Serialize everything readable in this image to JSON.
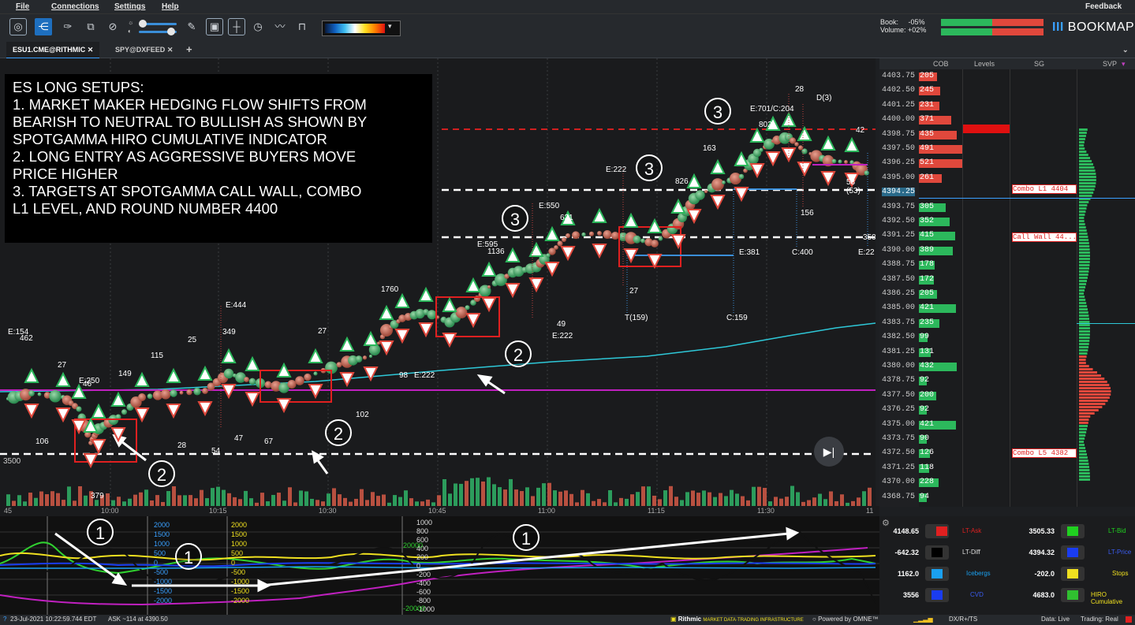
{
  "menu": {
    "file": "File",
    "connections": "Connections",
    "settings": "Settings",
    "help": "Help",
    "feedback": "Feedback"
  },
  "header": {
    "book_label": "Book:",
    "book_value": "-05%",
    "volume_label": "Volume:",
    "volume_value": "+02%",
    "brand": "BOOKMAP"
  },
  "tabs": [
    {
      "label": "ESU1.CME@RITHMIC"
    },
    {
      "label": "SPY@DXFEED"
    }
  ],
  "annotation": {
    "lines": [
      "ES LONG SETUPS:",
      "1. MARKET MAKER HEDGING FLOW SHIFTS FROM",
      "BEARISH TO NEUTRAL TO BULLISH AS SHOWN BY",
      "SPOTGAMMA HIRO CUMULATIVE INDICATOR",
      "2. LONG ENTRY AS AGGRESSIVE BUYERS MOVE",
      "PRICE HIGHER",
      "3. TARGETS AT SPOTGAMMA CALL WALL, COMBO",
      "L1 LEVEL, AND ROUND NUMBER 4400"
    ]
  },
  "markers": {
    "one": "1",
    "two": "2",
    "three": "3"
  },
  "right_headers": {
    "cob": "COB",
    "levels": "Levels",
    "sg": "SG",
    "svp": "SVP"
  },
  "price_levels": [
    {
      "price": "4403.75",
      "size": "205"
    },
    {
      "price": "4402.50",
      "size": "245"
    },
    {
      "price": "4401.25",
      "size": "231"
    },
    {
      "price": "4400.00",
      "size": "371"
    },
    {
      "price": "4398.75",
      "size": "435"
    },
    {
      "price": "4397.50",
      "size": "491"
    },
    {
      "price": "4396.25",
      "size": "521"
    },
    {
      "price": "4395.00",
      "size": "261"
    },
    {
      "price": "4394.25",
      "size": ""
    },
    {
      "price": "4393.75",
      "size": "305"
    },
    {
      "price": "4392.50",
      "size": "352"
    },
    {
      "price": "4391.25",
      "size": "415"
    },
    {
      "price": "4390.00",
      "size": "389"
    },
    {
      "price": "4388.75",
      "size": "178"
    },
    {
      "price": "4387.50",
      "size": "172"
    },
    {
      "price": "4386.25",
      "size": "205"
    },
    {
      "price": "4385.00",
      "size": "421"
    },
    {
      "price": "4383.75",
      "size": "235"
    },
    {
      "price": "4382.50",
      "size": "99"
    },
    {
      "price": "4381.25",
      "size": "131"
    },
    {
      "price": "4380.00",
      "size": "432"
    },
    {
      "price": "4378.75",
      "size": "92"
    },
    {
      "price": "4377.50",
      "size": "200"
    },
    {
      "price": "4376.25",
      "size": "92"
    },
    {
      "price": "4375.00",
      "size": "421"
    },
    {
      "price": "4373.75",
      "size": "90"
    },
    {
      "price": "4372.50",
      "size": "126"
    },
    {
      "price": "4371.25",
      "size": "118"
    },
    {
      "price": "4370.00",
      "size": "228"
    },
    {
      "price": "4368.75",
      "size": "94"
    }
  ],
  "sg_levels": {
    "combo_l1": "Combo L1 4404",
    "call_wall": "Call Wall 44...",
    "combo_l5": "Combo L5 4382"
  },
  "chart_labels": {
    "e154": "E:154",
    "v462": "462",
    "v27a": "27",
    "e250": "E:250",
    "v46": "46",
    "v149": "149",
    "v115": "115",
    "v25": "25",
    "e444": "E:444",
    "v349": "349",
    "v27b": "27",
    "v1760": "1760",
    "e595": "E:595",
    "v1136": "1136",
    "e550": "E:550",
    "v631": "631",
    "e222a": "E:222",
    "v826": "826",
    "v163": "163",
    "e701": "E:701/C:204",
    "v802": "802",
    "v28": "28",
    "d3": "D(3)",
    "v42": "42",
    "v106": "106",
    "v28b": "28",
    "v54": "54",
    "v47": "47",
    "v67": "67",
    "v102": "102",
    "v98": "98",
    "e222b": "E:222",
    "v379": "379",
    "v49": "49",
    "e222c": "E:222",
    "v27c": "27",
    "t159": "T(159)",
    "c159": "C:159",
    "e381": "E:381",
    "c400": "C:400",
    "v156": "156",
    "v350": "350",
    "e22": "E:22",
    "v53": "53 (53)",
    "v3500": "3500"
  },
  "time_labels": [
    "45",
    "10:00",
    "10:15",
    "10:30",
    "10:45",
    "11:00",
    "11:15",
    "11:30",
    "11"
  ],
  "indicator_scales": {
    "a": [
      "2000",
      "1500",
      "1000",
      "500",
      "0",
      "-500",
      "-1000",
      "-1500",
      "-2000"
    ],
    "b": [
      "2000",
      "1500",
      "1000",
      "500",
      "0",
      "-500",
      "-1000",
      "-1500",
      "-2000"
    ],
    "c": [
      "1000",
      "800",
      "600",
      "400",
      "200",
      "0",
      "-200",
      "-400",
      "-600",
      "-800",
      "-1000"
    ],
    "d": [
      "20000",
      "-20000"
    ]
  },
  "stats": [
    {
      "value": "4148.65",
      "label": "LT-Ask",
      "color": "#e02020",
      "value2": "3505.33",
      "label2": "LT-Bid",
      "color2": "#20d020"
    },
    {
      "value": "-642.32",
      "label": "LT-Diff",
      "color": "#000000",
      "value2": "4394.32",
      "label2": "LT-Price",
      "color2": "#1a3cf0"
    },
    {
      "value": "1162.0",
      "label": "Icebergs",
      "color": "#1aa0f0",
      "value2": "-202.0",
      "label2": "Stops",
      "color2": "#f0e020"
    },
    {
      "value": "3556",
      "label": "CVD",
      "color": "#1a3cf0",
      "value2": "4683.0",
      "label2": "HIRO Cumulative",
      "color2": "#30c030"
    }
  ],
  "statusbar": {
    "datetime": "23-Jul-2021 10:22:59.744 EDT",
    "ask": "ASK ~114 at 4390.50",
    "rithmic": "Rithmic",
    "rithmic_sub": "MARKET DATA·TRADING INFRASTRUCTURE",
    "powered": "Powered by OMNE™",
    "dxrts": "DX/R+/TS",
    "data": "Data: Live",
    "trading": "Trading: Real"
  },
  "colors": {
    "accent": "#1e6fbf",
    "hiro": "#30e030",
    "vwap": "#c020c0",
    "cyan": "#2ec8d8",
    "redline": "#e02020",
    "buy": "#2cb85c",
    "sell": "#e0483c"
  }
}
